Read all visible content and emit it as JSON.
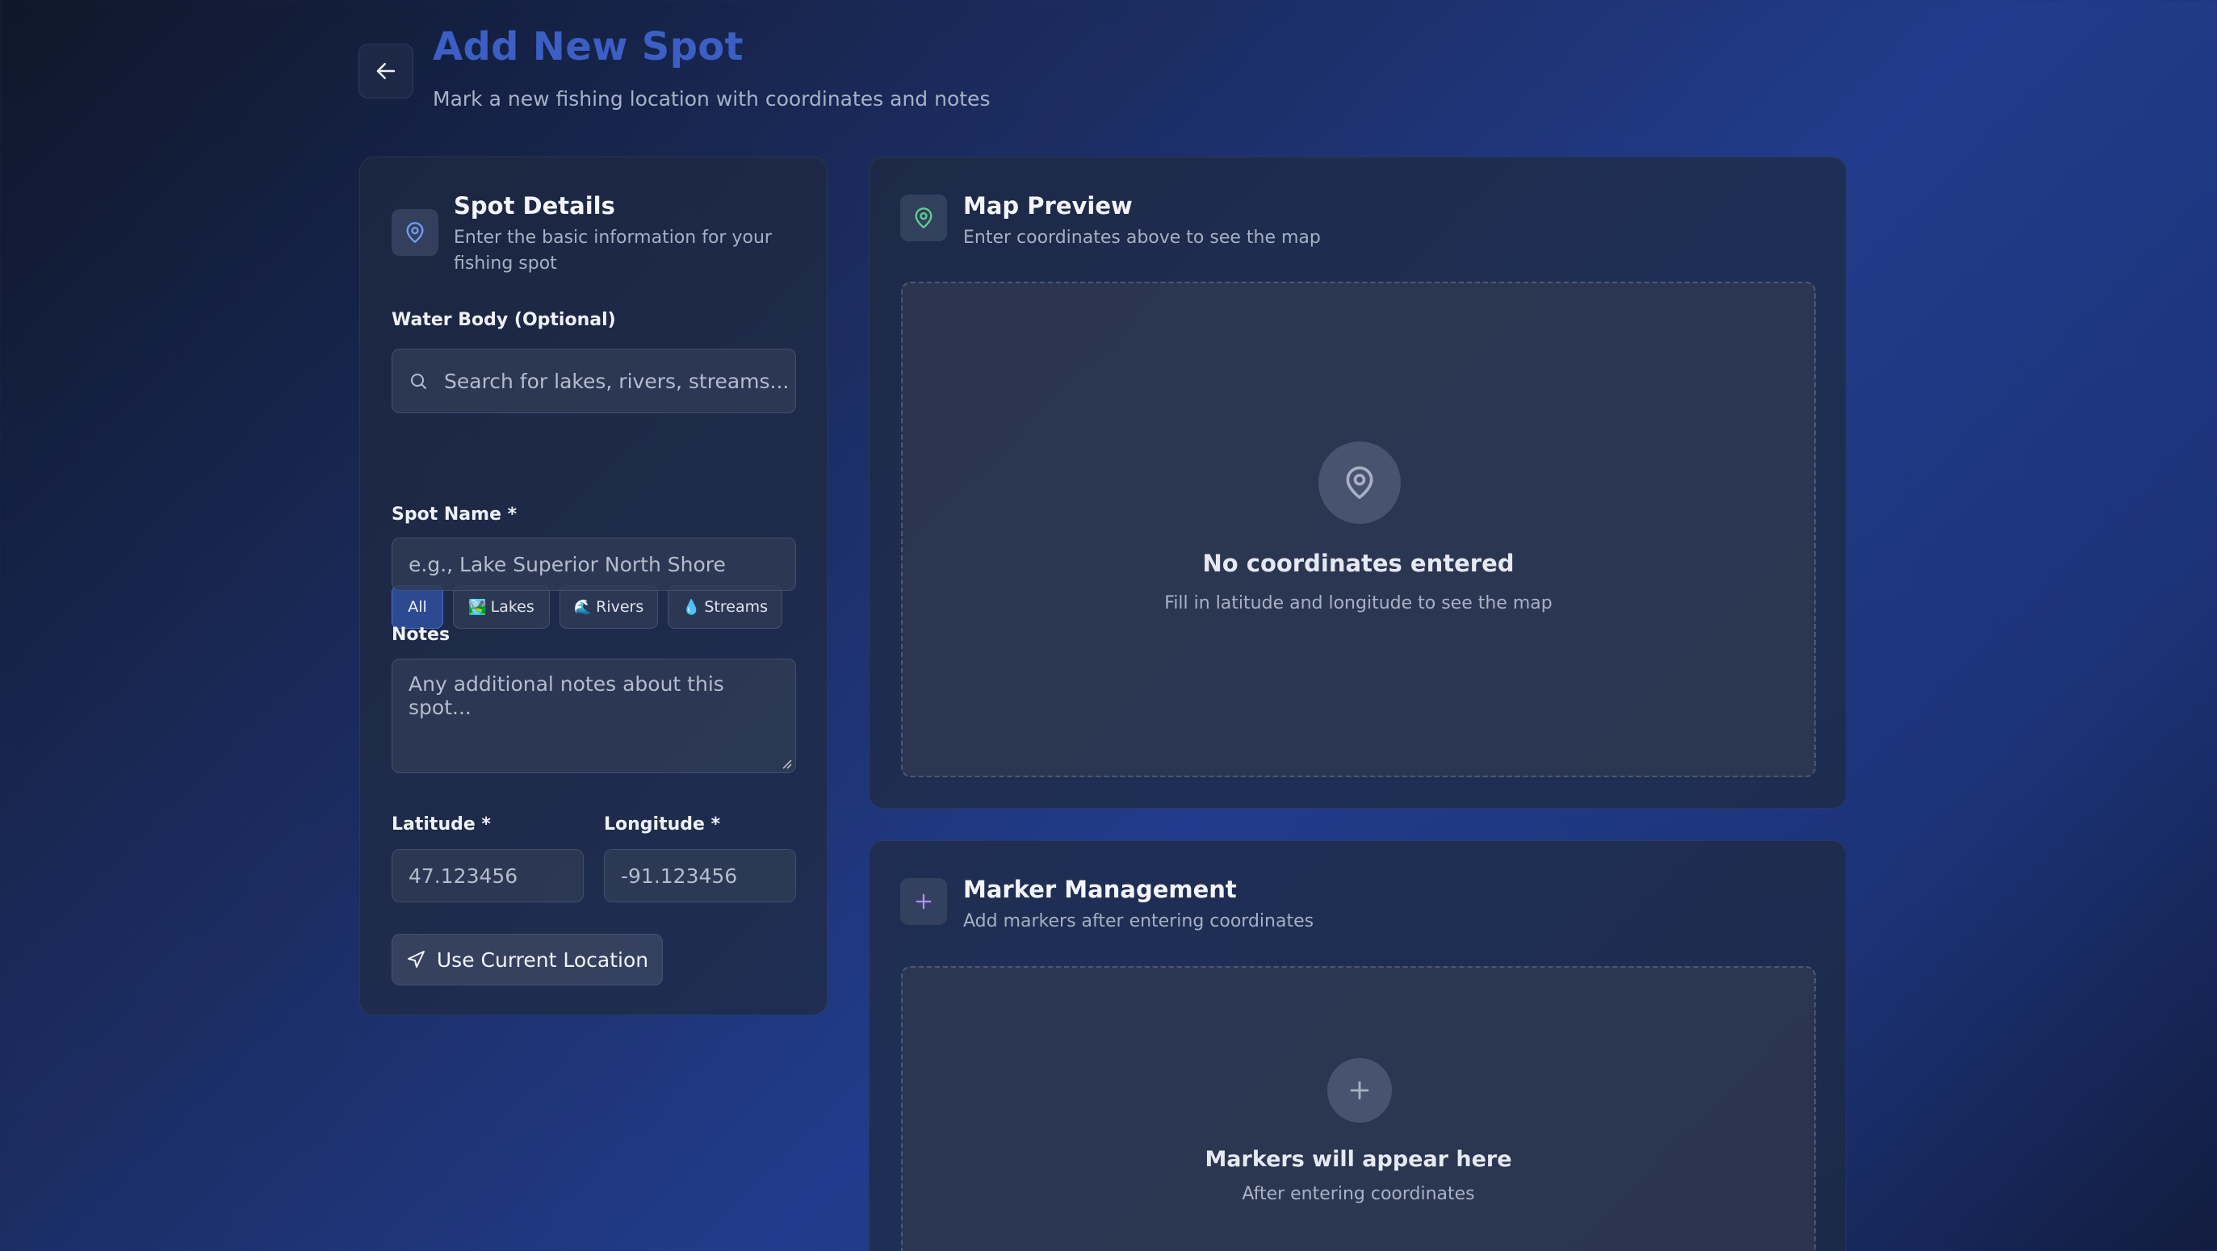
{
  "header": {
    "title": "Add New Spot",
    "subtitle": "Mark a new fishing location with coordinates and notes",
    "back_icon": "arrow-left-icon"
  },
  "spot_details": {
    "title": "Spot Details",
    "description": "Enter the basic information for your fishing spot",
    "icon": "map-pin-icon",
    "water_body": {
      "label": "Water Body (Optional)",
      "placeholder": "Search for lakes, rivers, streams...",
      "filters": [
        {
          "label": "All",
          "emoji": "",
          "active": true
        },
        {
          "label": "Lakes",
          "emoji": "🏞️",
          "active": false
        },
        {
          "label": "Rivers",
          "emoji": "🌊",
          "active": false
        },
        {
          "label": "Streams",
          "emoji": "💧",
          "active": false
        }
      ]
    },
    "spot_name": {
      "label": "Spot Name *",
      "placeholder": "e.g., Lake Superior North Shore"
    },
    "notes": {
      "label": "Notes",
      "placeholder": "Any additional notes about this spot..."
    },
    "latitude": {
      "label": "Latitude *",
      "placeholder": "47.123456"
    },
    "longitude": {
      "label": "Longitude *",
      "placeholder": "-91.123456"
    },
    "use_location_button": "Use Current Location"
  },
  "map_preview": {
    "title": "Map Preview",
    "description": "Enter coordinates above to see the map",
    "icon": "map-pin-icon",
    "empty_title": "No coordinates entered",
    "empty_subtitle": "Fill in latitude and longitude to see the map"
  },
  "marker_management": {
    "title": "Marker Management",
    "description": "Add markers after entering coordinates",
    "icon": "plus-icon",
    "empty_title": "Markers will appear here",
    "empty_subtitle": "After entering coordinates"
  },
  "colors": {
    "title_blue": "#3b5fc4",
    "accent_blue_icon": "#6f9cf2",
    "accent_green_icon": "#5fd08a",
    "accent_purple_icon": "#b58cf0",
    "active_chip": "#2c4a92"
  }
}
